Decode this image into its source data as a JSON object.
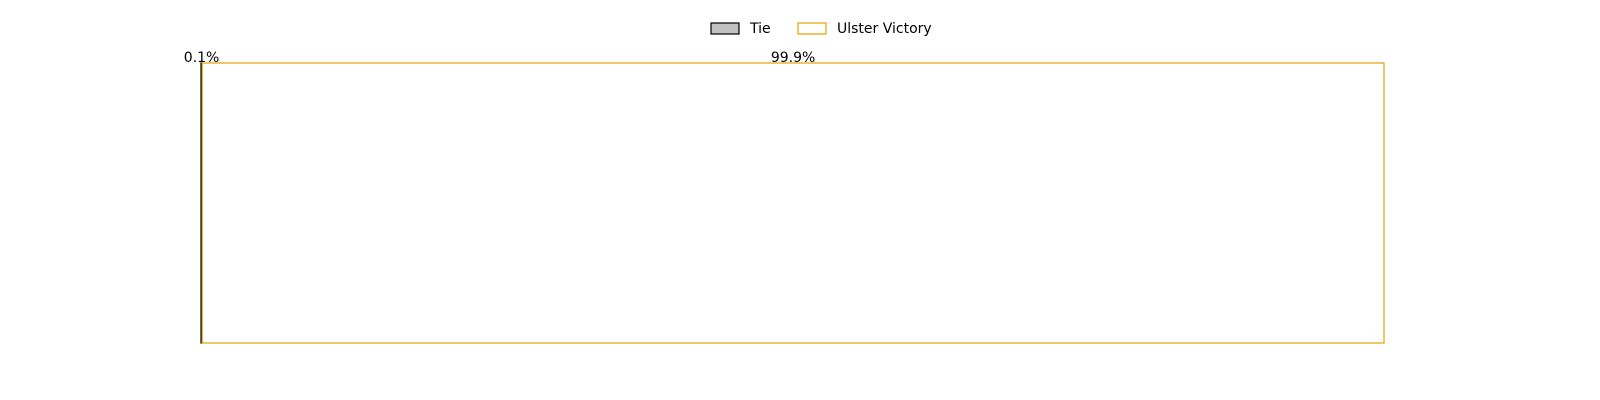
{
  "chart_data": {
    "type": "bar",
    "orientation": "horizontal-stacked",
    "legend_position": "top-center",
    "grid": false,
    "xlim": [
      0,
      100
    ],
    "series": [
      {
        "name": "Tie",
        "value": 0.1,
        "label": "0.1%",
        "fill": "#c0c0c0",
        "stroke": "#000000"
      },
      {
        "name": "Ulster Victory",
        "value": 99.9,
        "label": "99.9%",
        "fill": "#ffffff",
        "stroke": "#e69f00"
      }
    ]
  }
}
